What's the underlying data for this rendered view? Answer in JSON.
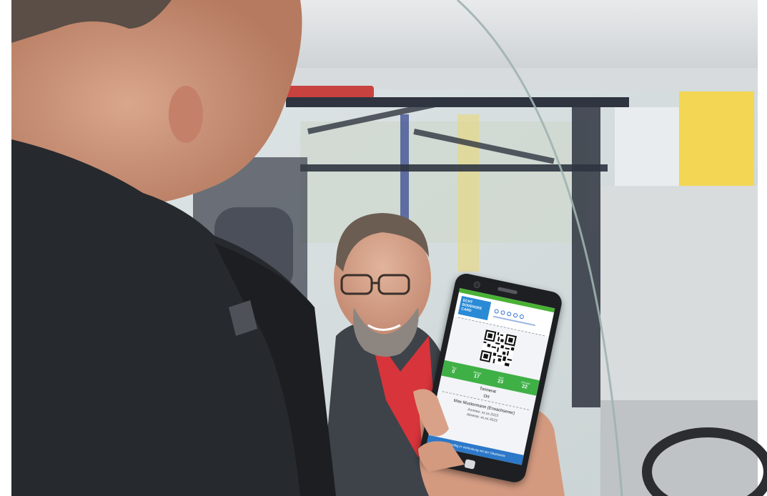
{
  "phone_screen": {
    "card_logo_text": "ECHT BODENSEE CARD",
    "stats": [
      {
        "label": "Tag",
        "value": "0"
      },
      {
        "label": "Monat",
        "value": "17"
      },
      {
        "label": "Jahr",
        "value": "23"
      },
      {
        "label": "Uhrzeit",
        "value": "22"
      }
    ],
    "line1": "Tonnerat",
    "line2": "Ort",
    "name": "Max Mustermann (Erwachsener)",
    "detail1": "Anreise: xx.xx.2023",
    "detail2": "Abreise: xx.xx.2023",
    "footer": "Nur gültig in Verbindung mit der Gästekarte"
  },
  "colors": {
    "ticket_green": "#3fb046",
    "ticket_blue": "#2c78c9",
    "shirt_red": "#d8343b"
  }
}
